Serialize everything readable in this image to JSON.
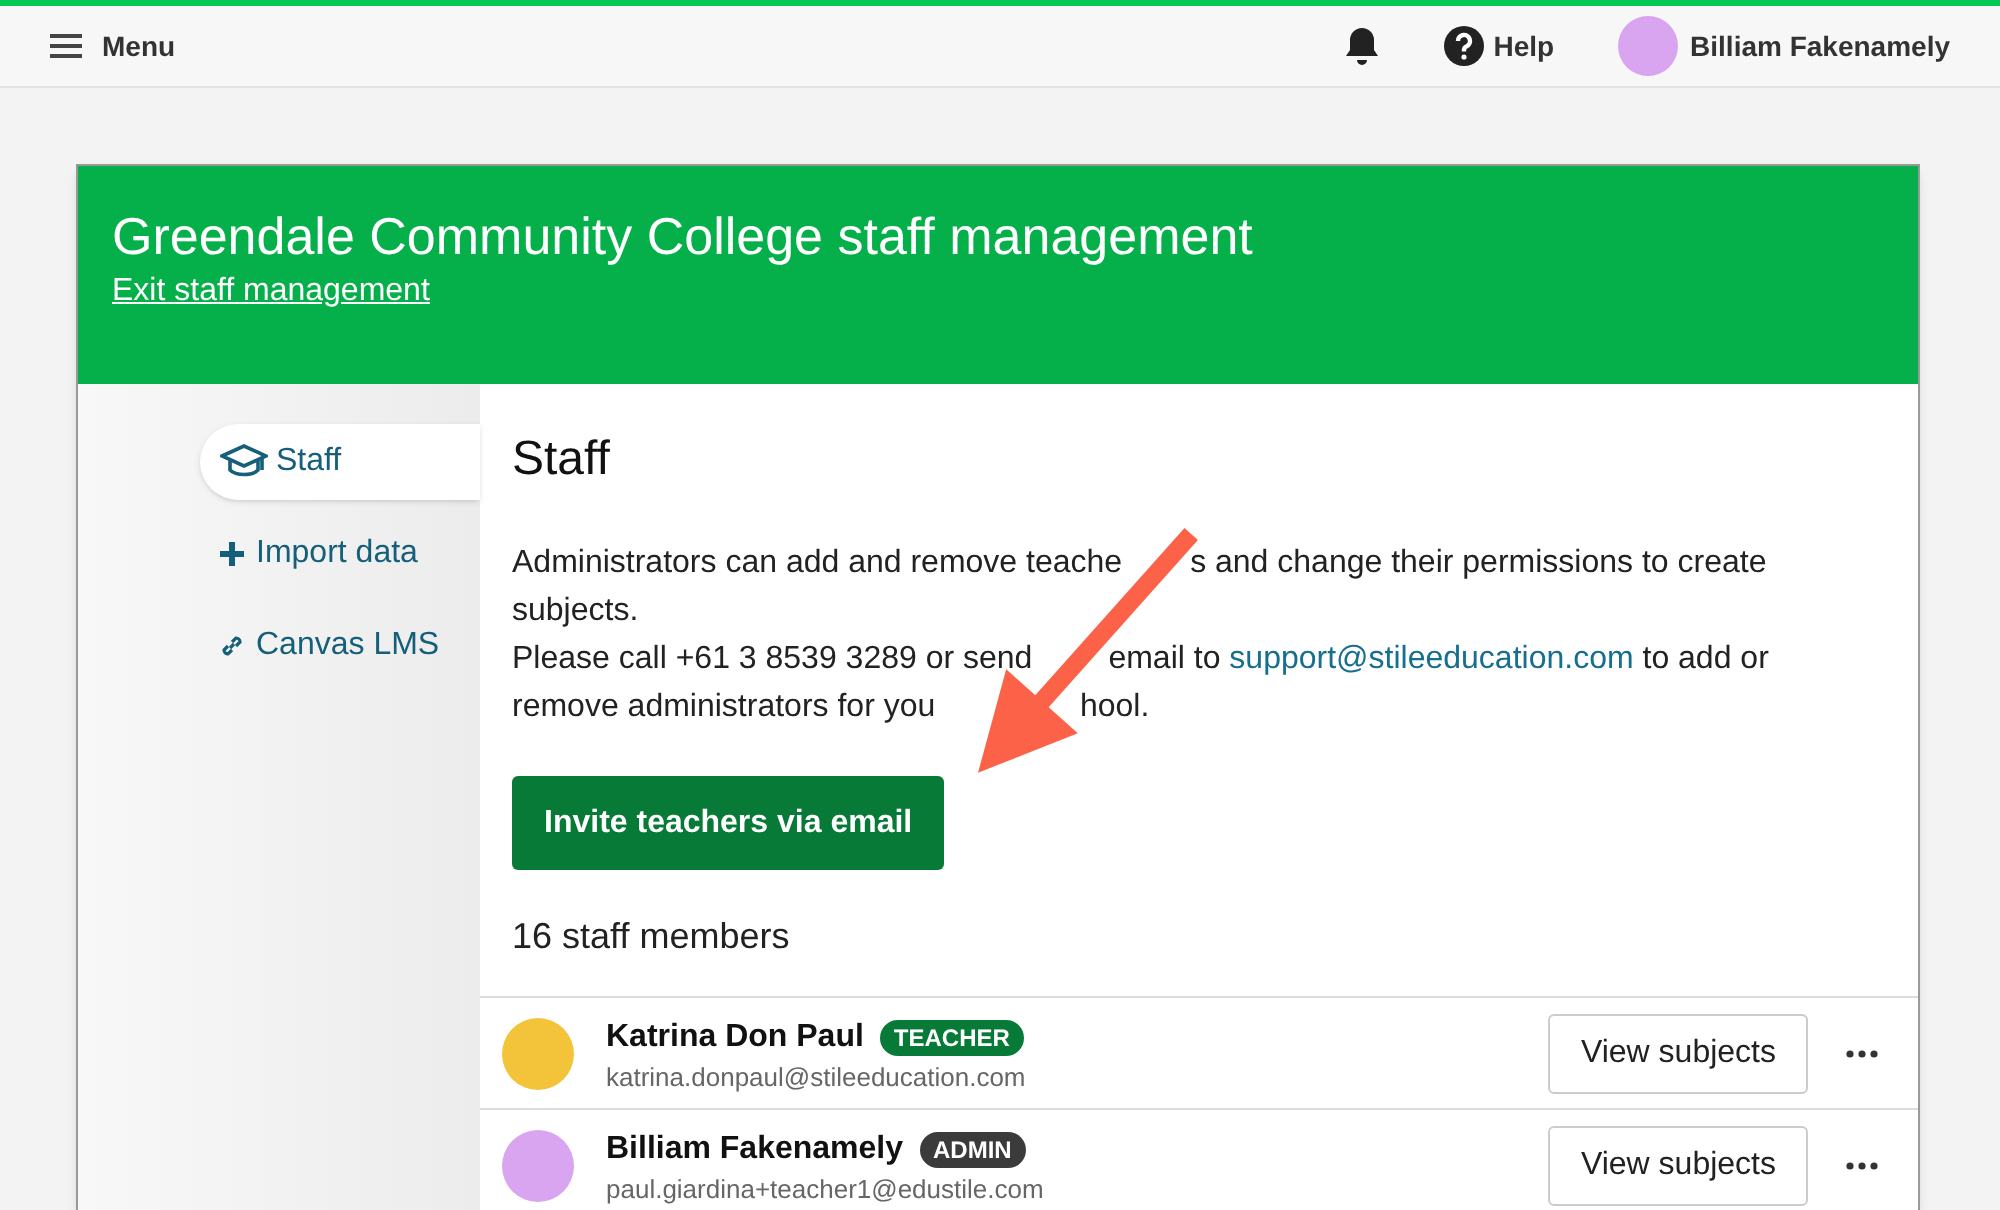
{
  "top_bar": {
    "menu": "Menu",
    "help": "Help",
    "user": "Billiam Fakenamely"
  },
  "header": {
    "title": "Greendale Community College staff management",
    "exit_link": "Exit staff management"
  },
  "sidebar": {
    "items": [
      {
        "label": "Staff",
        "selected": true
      },
      {
        "label": "Import data",
        "selected": false
      },
      {
        "label": "Canvas LMS",
        "selected": false
      }
    ]
  },
  "main": {
    "heading": "Staff",
    "paragraph_lines": [
      {
        "parts": [
          {
            "text": "Administrators can add and remove teache"
          },
          {
            "text": "s and change their permissions to create",
            "covered_before": true
          }
        ]
      },
      {
        "parts": [
          {
            "text": "subjects."
          }
        ]
      },
      {
        "parts": [
          {
            "text": "Please call +61 3 8539 3289 or send"
          },
          {
            "text": "email to ",
            "covered_before": true
          },
          {
            "text": "support@stileeducation.com",
            "kind": "link"
          },
          {
            "text": " to add or"
          }
        ]
      },
      {
        "parts": [
          {
            "text": "remove administrators for you"
          },
          {
            "text": "hool.",
            "covered_before": true
          }
        ]
      }
    ],
    "invite_button": "Invite teachers via email",
    "count": "16 staff members"
  },
  "staff": [
    {
      "name": "Katrina Don Paul",
      "role": "TEACHER",
      "kind": "teacher",
      "email": "katrina.donpaul@stileeducation.com",
      "button": "View subjects"
    },
    {
      "name": "Billiam Fakenamely",
      "role": "ADMIN",
      "kind": "admin",
      "email": "paul.giardina+teacher1@edustile.com",
      "button": "View subjects"
    }
  ]
}
